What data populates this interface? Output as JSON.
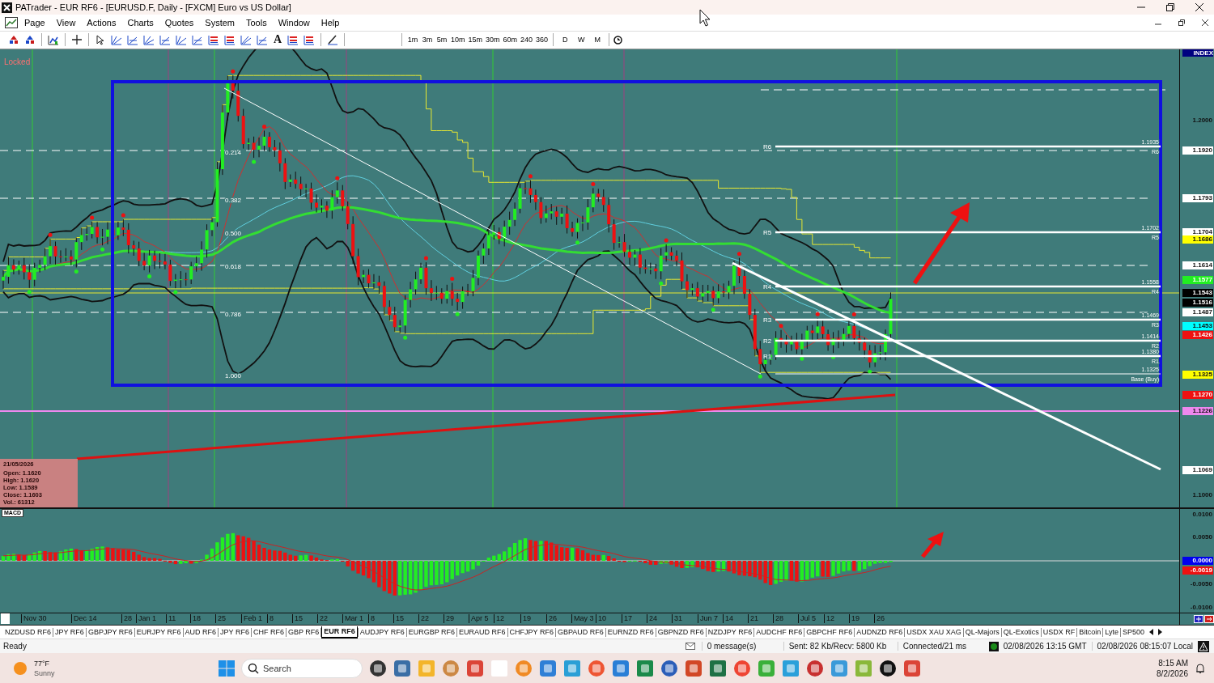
{
  "window": {
    "title": "PATrader - EUR RF6 - [EURUSD.F, Daily - [FXCM] Euro vs US Dollar]"
  },
  "menu": [
    "Page",
    "View",
    "Actions",
    "Charts",
    "Quotes",
    "System",
    "Tools",
    "Window",
    "Help"
  ],
  "toolbar": {
    "text_tool_glyph": "A",
    "timeframes": [
      "1m",
      "3m",
      "5m",
      "10m",
      "15m",
      "30m",
      "60m",
      "240",
      "360"
    ],
    "periods": [
      "D",
      "W",
      "M"
    ]
  },
  "chart": {
    "lock_label": "Locked",
    "fib_levels": [
      "0.214",
      "0.382",
      "0.500",
      "0.618",
      "0.786",
      "1.000"
    ],
    "pivots": [
      {
        "level": "R6",
        "value": "1.1935",
        "left_label": "R6"
      },
      {
        "level": "R5",
        "value": "1.1702",
        "left_label": "R5"
      },
      {
        "level": "R4",
        "value": "1.1558",
        "left_label": "R4"
      },
      {
        "level": "R3",
        "value": "1.1469",
        "left_label": "R3"
      },
      {
        "level": "R2",
        "value": "1.1414",
        "left_label": "R2"
      },
      {
        "level": "R1",
        "value": "1.1380",
        "left_label": "R1"
      },
      {
        "level": "Base (Buy)",
        "value": "1.1325"
      }
    ],
    "price_axis": {
      "header": "INDEX",
      "labels": [
        {
          "text": "1.2000"
        },
        {
          "text": "1.1920",
          "color": "#ffffff"
        },
        {
          "text": "1.1793",
          "color": "#ffffff"
        },
        {
          "text": "1.1704",
          "color": "#ffffff"
        },
        {
          "text": "1.1686",
          "color": "#ffff00"
        },
        {
          "text": "1.1614",
          "color": "#ffffff"
        },
        {
          "text": "1.1577",
          "color": "#22ee22"
        },
        {
          "text": "1.1543",
          "color": "#000000"
        },
        {
          "text": "1.1516",
          "color": "#000000"
        },
        {
          "text": "1.1487",
          "color": "#ffffff"
        },
        {
          "text": "1.1453",
          "color": "#00ffff"
        },
        {
          "text": "1.1426",
          "color": "#ee1111"
        },
        {
          "text": "1.1325",
          "color": "#ffff00"
        },
        {
          "text": "1.1270",
          "color": "#ee1111"
        },
        {
          "text": "1.1226",
          "color": "#ee88ee"
        },
        {
          "text": "1.1069",
          "color": "#ffffff"
        },
        {
          "text": "1.1000"
        }
      ]
    },
    "data_box": {
      "date": "21/05/2026",
      "lines": [
        "Open: 1.1620",
        "High: 1.1620",
        "Low: 1.1589",
        "Close: 1.1603",
        "Vol.: 61312"
      ]
    }
  },
  "macd": {
    "label": "MACD",
    "axis_labels": [
      {
        "text": "0.0100"
      },
      {
        "text": "0.0050"
      },
      {
        "text": "0.0000",
        "color": "#0000ee"
      },
      {
        "text": "-0.0019",
        "color": "#ee1111"
      },
      {
        "text": "-0.0050"
      },
      {
        "text": "-0.0100"
      }
    ]
  },
  "time_axis": [
    "Nov 30",
    "Dec 14",
    "28",
    "Jan 1",
    "11",
    "18",
    "25",
    "Feb 1",
    "8",
    "15",
    "22",
    "Mar 1",
    "8",
    "15",
    "22",
    "29",
    "Apr 5",
    "12",
    "19",
    "26",
    "May 3",
    "10",
    "17",
    "24",
    "31",
    "Jun 7",
    "14",
    "21",
    "28",
    "Jul 5",
    "12",
    "19",
    "26"
  ],
  "symbol_tabs": [
    {
      "label": "NZDUSD RF6",
      "selected": false
    },
    {
      "label": "JPY RF6",
      "selected": false
    },
    {
      "label": "GBPJPY RF6",
      "selected": false
    },
    {
      "label": "EURJPY RF6",
      "selected": false
    },
    {
      "label": "AUD RF6",
      "selected": false
    },
    {
      "label": "JPY RF6",
      "selected": false
    },
    {
      "label": "CHF RF6",
      "selected": false
    },
    {
      "label": "GBP RF6",
      "selected": false
    },
    {
      "label": "EUR RF6",
      "selected": true
    },
    {
      "label": "AUDJPY RF6",
      "selected": false
    },
    {
      "label": "EURGBP RF6",
      "selected": false
    },
    {
      "label": "EURAUD RF6",
      "selected": false
    },
    {
      "label": "CHFJPY RF6",
      "selected": false
    },
    {
      "label": "GBPAUD RF6",
      "selected": false
    },
    {
      "label": "EURNZD RF6",
      "selected": false
    },
    {
      "label": "GBPNZD RF6",
      "selected": false
    },
    {
      "label": "NZDJPY RF6",
      "selected": false
    },
    {
      "label": "AUDCHF RF6",
      "selected": false
    },
    {
      "label": "GBPCHF RF6",
      "selected": false
    },
    {
      "label": "AUDNZD RF6",
      "selected": false
    },
    {
      "label": "USDX XAU XAG",
      "selected": false
    },
    {
      "label": "QL-Majors",
      "selected": false
    },
    {
      "label": "QL-Exotics",
      "selected": false
    },
    {
      "label": "USDX RF",
      "selected": false
    },
    {
      "label": "Bitcoin",
      "selected": false
    },
    {
      "label": "Lyte",
      "selected": false
    },
    {
      "label": "SP500",
      "selected": false
    }
  ],
  "status_bar": {
    "text": "Ready",
    "messages": "0 message(s)",
    "traffic": "Sent: 82 Kb/Recv: 5800 Kb",
    "connection": "Connected/21 ms",
    "gmt_time": "02/08/2026 13:15 GMT",
    "local_time": "02/08/2026 08:15:07 Local"
  },
  "taskbar": {
    "weather": {
      "temp": "77°F",
      "condition": "Sunny"
    },
    "search": {
      "placeholder": "Search"
    },
    "time": "8:15 AM",
    "date": "8/2/2026"
  }
}
